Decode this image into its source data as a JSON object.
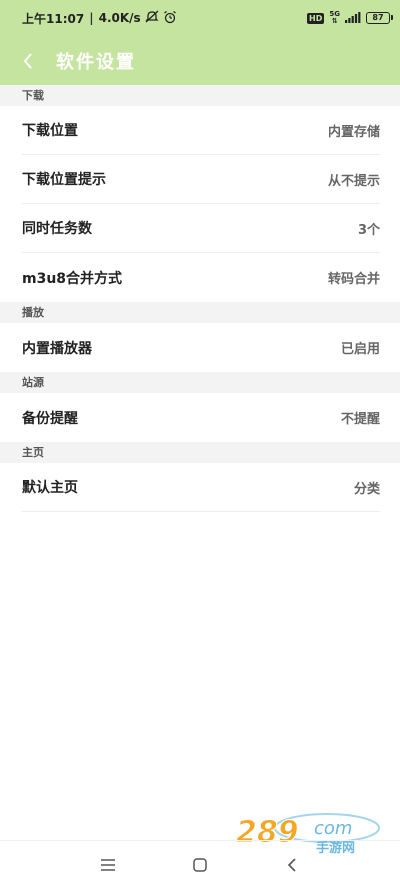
{
  "status_bar": {
    "time": "上午11:07",
    "speed": "4.0K/s",
    "network": "5G",
    "battery": "87",
    "icons": [
      "mute-icon",
      "alarm-icon",
      "hd-icon",
      "signal-icon",
      "battery-icon"
    ]
  },
  "header": {
    "title": "软件设置",
    "back_icon": "chevron-left-icon",
    "background": "#c5e4a0"
  },
  "sections": [
    {
      "title": "下载",
      "rows": [
        {
          "label": "下载位置",
          "value": "内置存储"
        },
        {
          "label": "下载位置提示",
          "value": "从不提示"
        },
        {
          "label": "同时任务数",
          "value": "3个"
        },
        {
          "label": "m3u8合并方式",
          "value": "转码合并"
        }
      ]
    },
    {
      "title": "播放",
      "rows": [
        {
          "label": "内置播放器",
          "value": "已启用"
        }
      ]
    },
    {
      "title": "站源",
      "rows": [
        {
          "label": "备份提醒",
          "value": "不提醒"
        }
      ]
    },
    {
      "title": "主页",
      "rows": [
        {
          "label": "默认主页",
          "value": "分类"
        }
      ]
    }
  ],
  "nav_bar": {
    "icons": [
      "menu-icon",
      "home-square-icon",
      "back-triangle-icon"
    ]
  },
  "watermark": {
    "number": "289",
    "suffix": "com",
    "subtitle": "手游网"
  }
}
